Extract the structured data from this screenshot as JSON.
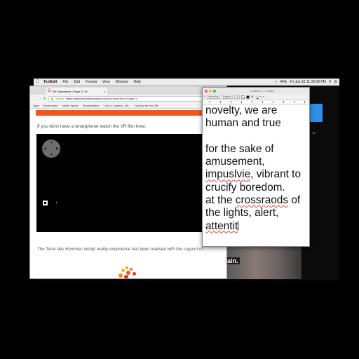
{
  "menubar": {
    "apple": "",
    "app_name": "TextEdit",
    "items": [
      "File",
      "Edit",
      "Format",
      "View",
      "Window",
      "Help"
    ],
    "battery": "44%",
    "clock": "Fri Jun 15  11:39:08 PM"
  },
  "desktop": {
    "caption": "ain.",
    "side_label": "th"
  },
  "browser": {
    "tab_title": "VR Experience | Page 3 | Te",
    "tab_close": "×",
    "secure_label": "Secure",
    "url_host": "https://www.terredeshommes.nl",
    "url_path": "/actie-experience?page=3",
    "bookmarks": [
      "Apps",
      "Bookmarks",
      "Artists Space",
      "SimpleAddon",
      "'I Am a Camera - Wi...",
      "Society for the Diff..."
    ],
    "page": {
      "intro_text": "If you don't have a smartphone watch the VR film here:",
      "support_text": "The Terre des Hommes virtual reality experience has been realised with the support of:"
    }
  },
  "textedit": {
    "window_title": "Untitled 3 — Edited",
    "font_style": "Helvetica",
    "font_weight": "Regular",
    "font_size": "18",
    "body_lines": [
      "novelty, we are",
      "human and true",
      "",
      "for the sake of",
      "amusement,",
      "impuslvie, vibrant to",
      "crucify boredom.",
      "at the crossraods of",
      "the lights, alert,",
      "attentit"
    ]
  },
  "colors": {
    "accent_orange": "#f0561f",
    "secure_green": "#1b8a2a",
    "desktop_blue": "#2d8fe6",
    "spell_underline": "#e0443a"
  }
}
